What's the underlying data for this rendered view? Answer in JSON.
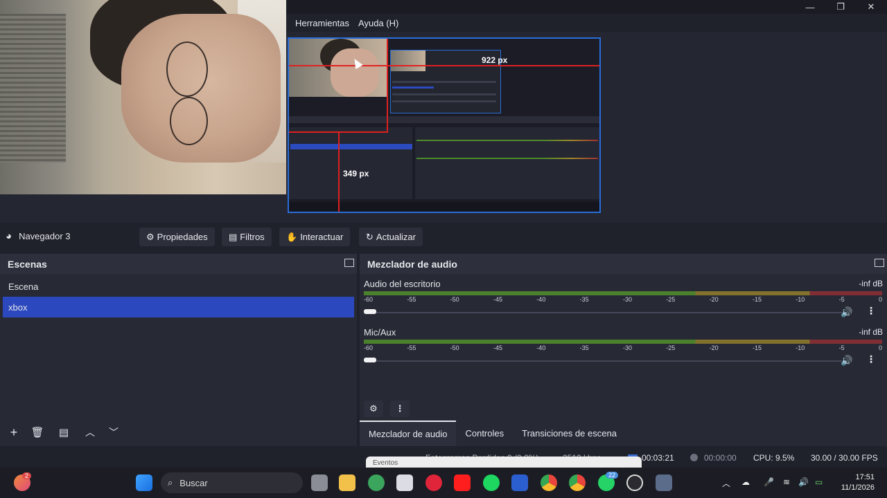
{
  "window": {
    "minimize": "—",
    "maximize": "❐",
    "close": "✕"
  },
  "menu": {
    "tools": "Herramientas",
    "help": "Ayuda (H)"
  },
  "preview": {
    "width_label": "922 px",
    "height_label": "349 px"
  },
  "source_toolbar": {
    "source_name": "Navegador 3",
    "properties": "Propiedades",
    "filters": "Filtros",
    "interact": "Interactuar",
    "refresh": "Actualizar"
  },
  "scenes": {
    "title": "Escenas",
    "items": [
      {
        "label": "Escena",
        "selected": false
      },
      {
        "label": "xbox",
        "selected": true
      }
    ]
  },
  "mixer": {
    "title": "Mezclador de audio",
    "ticks": [
      "-60",
      "-55",
      "-50",
      "-45",
      "-40",
      "-35",
      "-30",
      "-25",
      "-20",
      "-15",
      "-10",
      "-5",
      "0"
    ],
    "channels": [
      {
        "name": "Audio del escritorio",
        "level": "-inf dB"
      },
      {
        "name": "Mic/Aux",
        "level": "-inf dB"
      }
    ]
  },
  "tabs": [
    "Mezclador de audio",
    "Controles",
    "Transiciones de escena"
  ],
  "status": {
    "dropped_frames": "Fotogramas Perdidos 0 (0.0%)",
    "bitrate": "3512 kbps",
    "stream_time": "00:03:21",
    "rec_time": "00:00:00",
    "cpu": "CPU: 9.5%",
    "fps": "30.00 / 30.00 FPS",
    "events_popup": "Eventos"
  },
  "taskbar": {
    "search_placeholder": "Buscar",
    "time": "17:51",
    "date": "11/1/2026",
    "notification_badge": "2",
    "whatsapp_badge": "22"
  }
}
